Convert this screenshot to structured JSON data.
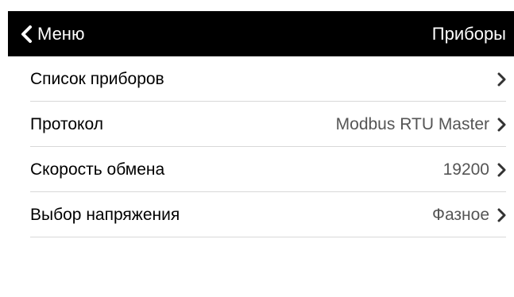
{
  "header": {
    "back_label": "Меню",
    "title": "Приборы",
    "back_icon": "chevron-left-icon"
  },
  "rows": [
    {
      "label": "Список приборов",
      "value": ""
    },
    {
      "label": "Протокол",
      "value": "Modbus RTU Master"
    },
    {
      "label": "Скорость обмена",
      "value": "19200"
    },
    {
      "label": "Выбор напряжения",
      "value": "Фазное"
    }
  ],
  "colors": {
    "header_bg": "#000000",
    "header_text": "#ffffff",
    "label_text": "#000000",
    "value_text": "#555555",
    "divider": "#d8d8d8"
  }
}
